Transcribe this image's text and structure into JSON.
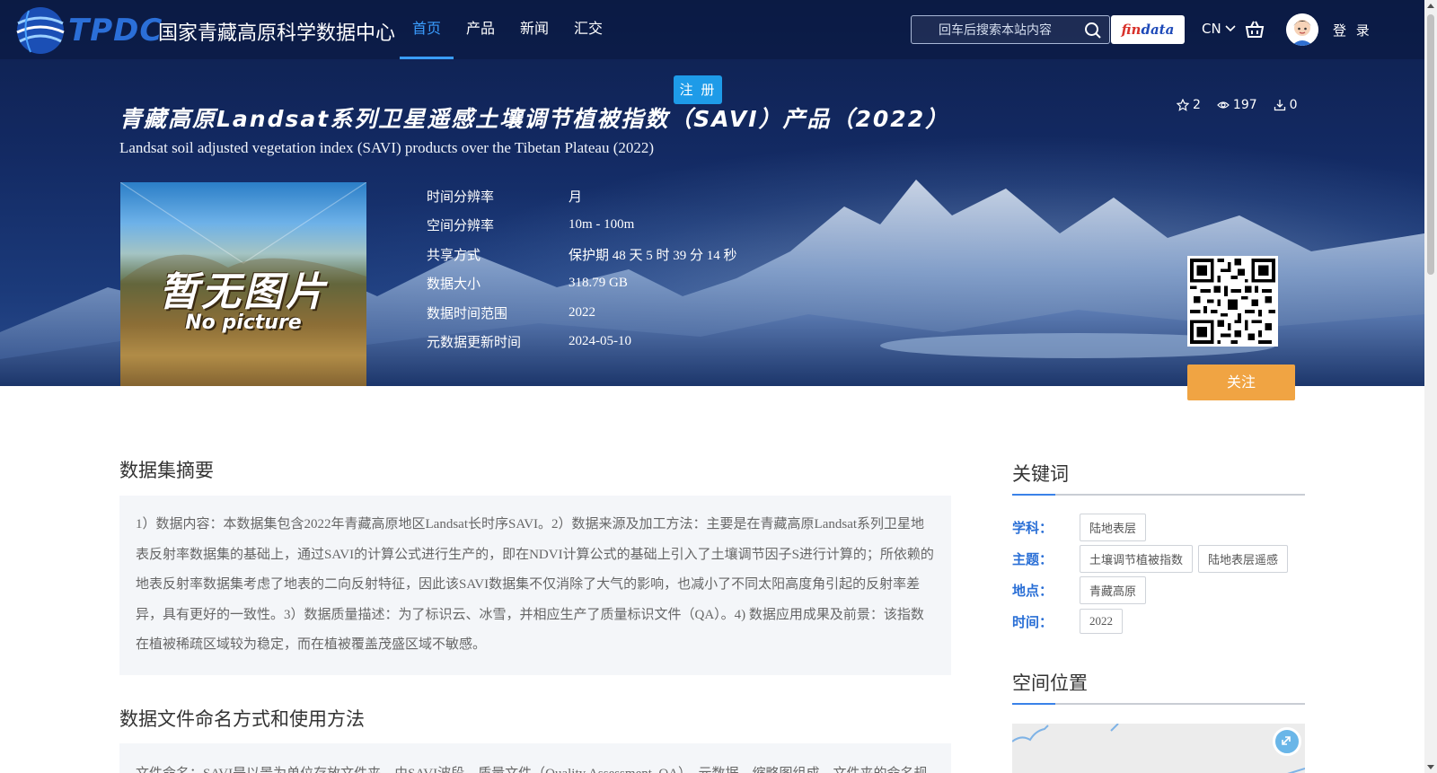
{
  "header": {
    "logo_text": "TPDC",
    "logo_cn": "国家青藏高原科学数据中心",
    "nav": [
      {
        "label": "首页",
        "active": true
      },
      {
        "label": "产品",
        "active": false
      },
      {
        "label": "新闻",
        "active": false
      },
      {
        "label": "汇交",
        "active": false
      }
    ],
    "search_placeholder": "回车后搜索本站内容",
    "findata_part1": "fin",
    "findata_part2": "data",
    "lang": "CN",
    "login": "登 录",
    "register": "注 册"
  },
  "dataset": {
    "title_cn": "青藏高原Landsat系列卫星遥感土壤调节植被指数（SAVI）产品（2022）",
    "title_en": "Landsat soil adjusted vegetation index (SAVI) products over the Tibetan Plateau (2022)",
    "stars": "2",
    "views": "197",
    "downloads": "0",
    "thumb_cn": "暂无图片",
    "thumb_en": "No picture",
    "meta": [
      {
        "label": "时间分辨率",
        "value": "月"
      },
      {
        "label": "空间分辨率",
        "value": "10m - 100m"
      },
      {
        "label": "共享方式",
        "value": "保护期 48 天 5 时 39 分 14 秒"
      },
      {
        "label": "数据大小",
        "value": "318.79 GB"
      },
      {
        "label": "数据时间范围",
        "value": "2022"
      },
      {
        "label": "元数据更新时间",
        "value": "2024-05-10"
      }
    ],
    "follow": "关注"
  },
  "main": {
    "abstract_title": "数据集摘要",
    "abstract_text": "1）数据内容：本数据集包含2022年青藏高原地区Landsat长时序SAVI。2）数据来源及加工方法：主要是在青藏高原Landsat系列卫星地表反射率数据集的基础上，通过SAVI的计算公式进行生产的，即在NDVI计算公式的基础上引入了土壤调节因子S进行计算的；所依赖的地表反射率数据集考虑了地表的二向反射特征，因此该SAVI数据集不仅消除了大气的影响，也减小了不同太阳高度角引起的反射率差异，具有更好的一致性。3）数据质量描述：为了标识云、冰雪，并相应生产了质量标识文件（QA）。4) 数据应用成果及前景：该指数在植被稀疏区域较为稳定，而在植被覆盖茂盛区域不敏感。",
    "naming_title": "数据文件命名方式和使用方法",
    "naming_text": "文件命名：SAVI是以景为单位存放文件夹，由SAVI波段、质量文件（Quality Assessment, QA）、元数据、缩略图组成，文件夹的命名规"
  },
  "sidebar": {
    "keywords_title": "关键词",
    "rows": [
      {
        "label": "学科：",
        "tags": [
          "陆地表层"
        ]
      },
      {
        "label": "主题：",
        "tags": [
          "土壤调节植被指数",
          "陆地表层遥感"
        ]
      },
      {
        "label": "地点：",
        "tags": [
          "青藏高原"
        ]
      },
      {
        "label": "时间：",
        "tags": [
          "2022"
        ]
      }
    ],
    "location_title": "空间位置"
  },
  "colors": {
    "accent": "#3a9dff",
    "follow": "#f0a443",
    "register": "#1e9be8",
    "keyword_label": "#2a6fd6"
  }
}
